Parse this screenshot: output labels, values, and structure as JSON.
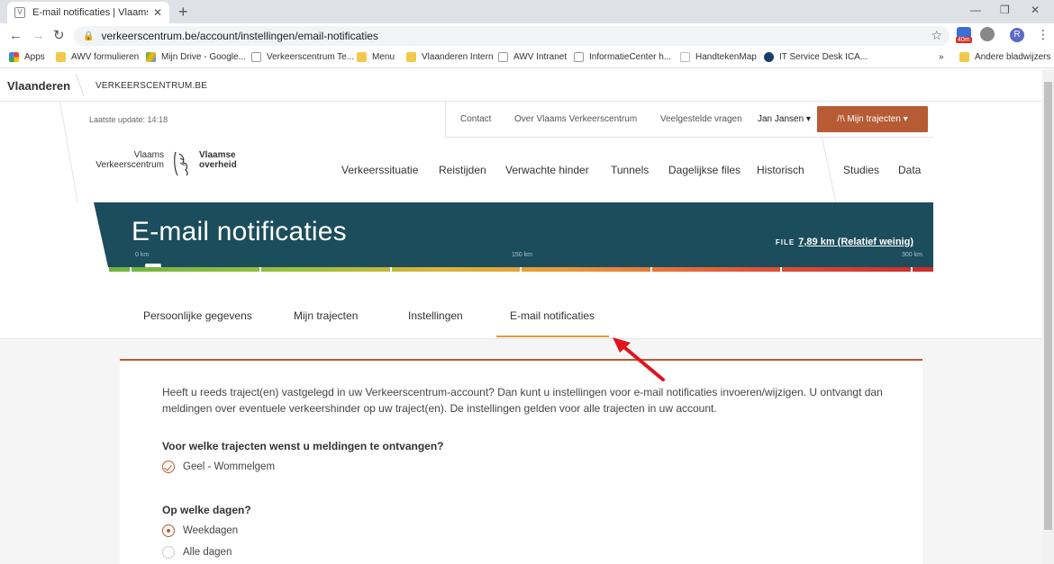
{
  "browser": {
    "tab_title": "E-mail notificaties | Vlaams Verke",
    "url": "verkeerscentrum.be/account/instellingen/email-notificaties",
    "ext_badge": "40m",
    "profile_initial": "R",
    "bookmarks": [
      "Apps",
      "AWV formulieren",
      "Mijn Drive - Google...",
      "Verkeerscentrum Te...",
      "Menu",
      "Vlaanderen Intern",
      "AWV Intranet",
      "InformatieCenter h...",
      "HandtekenMap",
      "IT Service Desk ICA..."
    ],
    "bookmarks_overflow": "»",
    "other_bookmarks": "Andere bladwijzers"
  },
  "site": {
    "vlaanderen": "Vlaanderen",
    "site_name": "VERKEERSCENTRUM.BE",
    "last_update": "Laatste update: 14:18",
    "topnav": [
      "Contact",
      "Over Vlaams Verkeerscentrum",
      "Veelgestelde vragen"
    ],
    "user": "Jan Jansen ▾",
    "my_routes_button": "/!\\  Mijn trajecten ▾",
    "logo_left": "Vlaams\nVerkeerscentrum",
    "logo_right": "Vlaamse\noverheid",
    "mainnav": [
      "Verkeerssituatie",
      "Reistijden",
      "Verwachte hinder",
      "Tunnels",
      "Dagelijkse files",
      "Historisch",
      "Studies",
      "Data"
    ]
  },
  "banner": {
    "title": "E-mail notificaties",
    "file_label": "FILE",
    "file_value": "7,89 km (Relatief weinig)",
    "km_labels": [
      "0 km",
      "150 km",
      "300 km"
    ],
    "traffic_fraction": 0.026
  },
  "tabs": [
    "Persoonlijke gegevens",
    "Mijn trajecten",
    "Instellingen",
    "E-mail notificaties"
  ],
  "active_tab": "E-mail notificaties",
  "content": {
    "intro": "Heeft u reeds traject(en) vastgelegd in uw Verkeerscentrum-account? Dan kunt u instellingen voor e-mail notificaties invoeren/wijzigen. U ontvangt dan meldingen over eventuele verkeershinder op uw traject(en). De instellingen gelden voor alle trajecten in uw account.",
    "q1": "Voor welke trajecten wenst u meldingen te ontvangen?",
    "q1_option": "Geel - Wommelgem",
    "q2": "Op welke dagen?",
    "q2_options": [
      "Weekdagen",
      "Alle dagen"
    ],
    "q2_selected": "Weekdagen"
  },
  "colors": {
    "accent": "#b65b34",
    "banner": "#1b4d5c",
    "tab_underline": "#e89a3b",
    "annotation_arrow": "#e0141e"
  }
}
